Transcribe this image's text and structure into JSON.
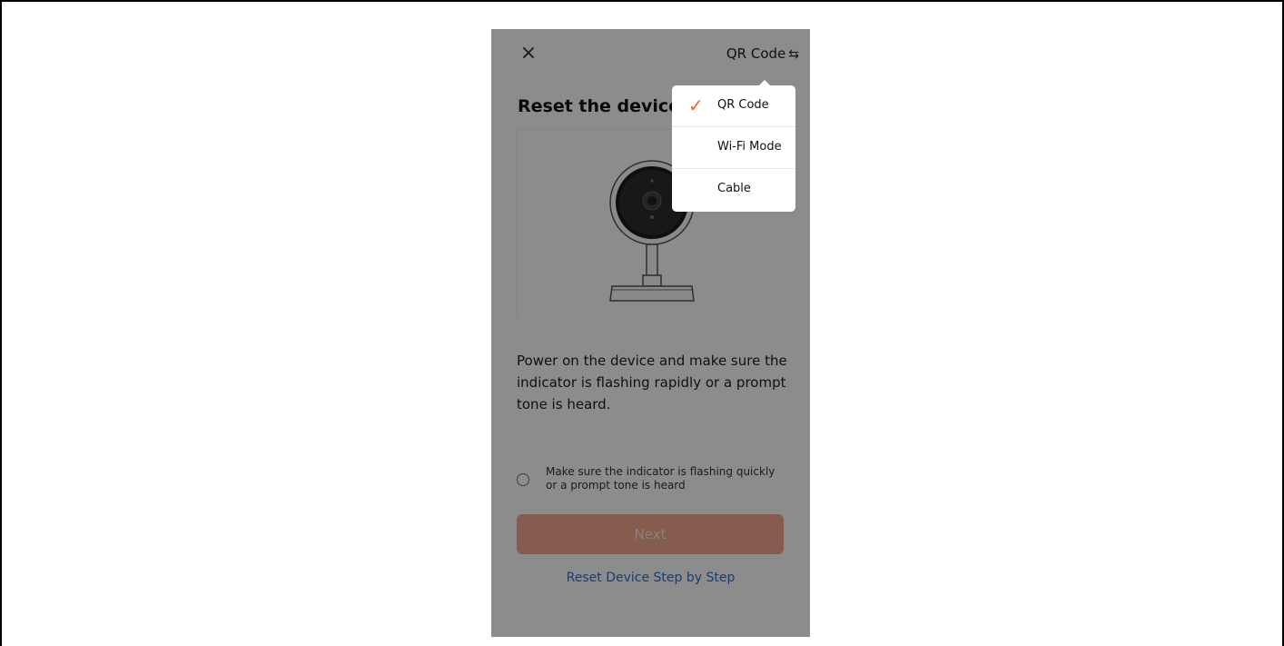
{
  "header": {
    "close_icon": "×",
    "mode_switch_label": "QR Code",
    "swap_icon": "⇆"
  },
  "page": {
    "title": "Reset the device",
    "instruction": "Power on the device and make sure the indicator is flashing rapidly or a prompt tone is heard.",
    "confirm_text": "Make sure the indicator is flashing quickly or a prompt tone is heard",
    "confirm_checked": false,
    "next_label": "Next",
    "reset_link": "Reset Device Step by Step"
  },
  "mode_menu": {
    "check_icon": "✓",
    "items": [
      {
        "label": "QR Code",
        "selected": true
      },
      {
        "label": "Wi-Fi Mode",
        "selected": false
      },
      {
        "label": "Cable",
        "selected": false
      }
    ]
  },
  "colors": {
    "accent": "#f0622e",
    "next_button_disabled": "#f3a88f",
    "link": "#2a6fd0",
    "overlay": "rgba(0,0,0,0.45)"
  }
}
